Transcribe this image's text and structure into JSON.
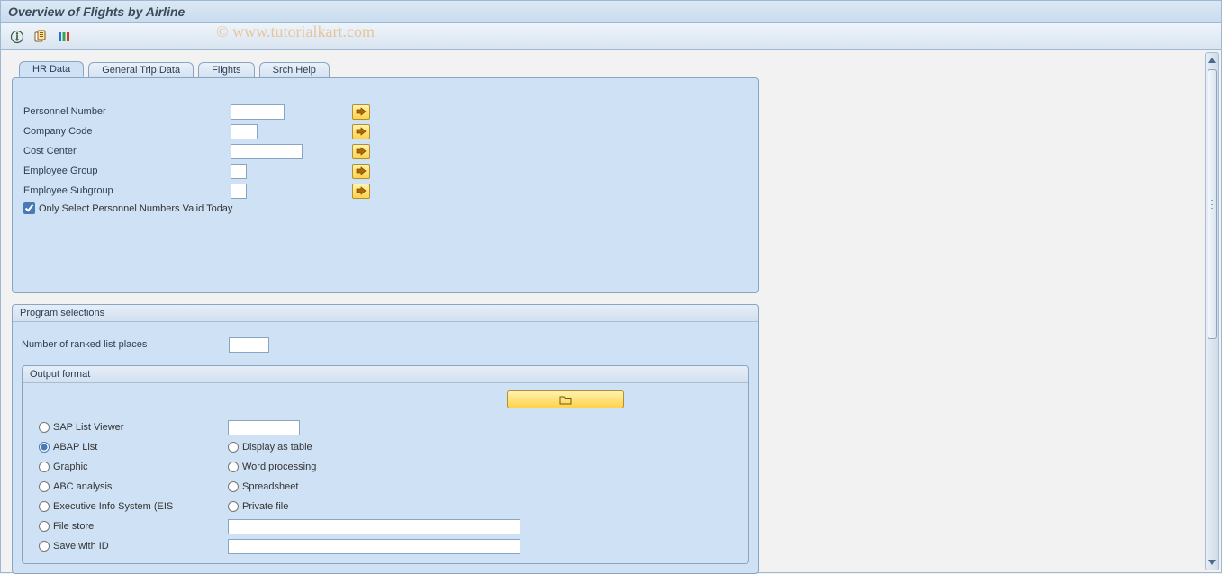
{
  "title": "Overview of Flights by Airline",
  "watermark": "© www.tutorialkart.com",
  "tabs": {
    "a": "HR Data",
    "b": "General Trip Data",
    "c": "Flights",
    "d": "Srch Help"
  },
  "hr": {
    "personnel_number": "Personnel Number",
    "company_code": "Company Code",
    "cost_center": "Cost Center",
    "employee_group": "Employee Group",
    "employee_subgroup": "Employee Subgroup",
    "only_valid_today": "Only Select Personnel Numbers Valid Today"
  },
  "prog_sel": {
    "title": "Program selections",
    "ranked_places": "Number of ranked list places"
  },
  "output": {
    "title": "Output format",
    "sap_list_viewer": "SAP List Viewer",
    "abap_list": "ABAP List",
    "display_as_table": "Display as table",
    "graphic": "Graphic",
    "word_processing": "Word processing",
    "abc_analysis": "ABC analysis",
    "spreadsheet": "Spreadsheet",
    "eis": "Executive Info System (EIS",
    "private_file": "Private file",
    "file_store": "File store",
    "save_with_id": "Save with ID"
  }
}
